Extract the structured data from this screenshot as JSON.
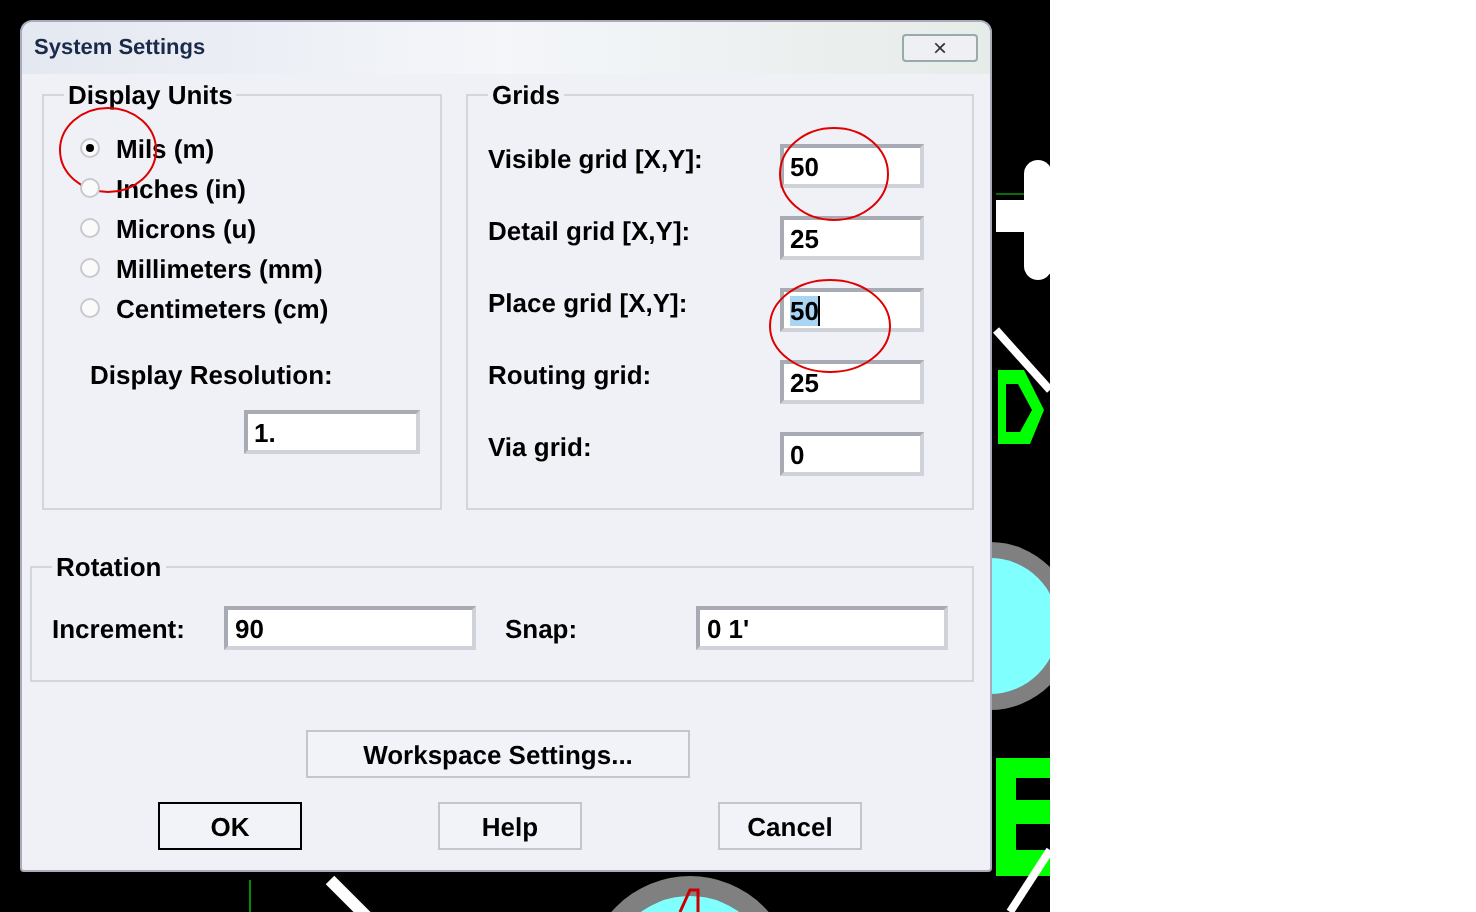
{
  "window": {
    "title": "System Settings",
    "close": "×"
  },
  "display_units": {
    "title": "Display Units",
    "options": [
      {
        "label": "Mils (m)",
        "selected": true
      },
      {
        "label": "Inches (in)",
        "selected": false
      },
      {
        "label": "Microns (u)",
        "selected": false
      },
      {
        "label": "Millimeters (mm)",
        "selected": false
      },
      {
        "label": "Centimeters (cm)",
        "selected": false
      }
    ],
    "resolution_label": "Display Resolution:",
    "resolution_value": "1."
  },
  "grids": {
    "title": "Grids",
    "fields": [
      {
        "label": "Visible grid [X,Y]:",
        "value": "50",
        "focused": false
      },
      {
        "label": "Detail grid [X,Y]:",
        "value": "25",
        "focused": false
      },
      {
        "label": "Place grid [X,Y]:",
        "value": "50",
        "focused": true
      },
      {
        "label": "Routing grid:",
        "value": "25",
        "focused": false
      },
      {
        "label": "Via grid:",
        "value": "0",
        "focused": false
      }
    ]
  },
  "rotation": {
    "title": "Rotation",
    "increment_label": "Increment:",
    "increment_value": "90",
    "snap_label": "Snap:",
    "snap_value": "0 1'"
  },
  "buttons": [
    {
      "label": "Workspace Settings...",
      "default": false
    },
    {
      "label": "OK",
      "default": true
    },
    {
      "label": "Help",
      "default": false
    },
    {
      "label": "Cancel",
      "default": false
    }
  ]
}
